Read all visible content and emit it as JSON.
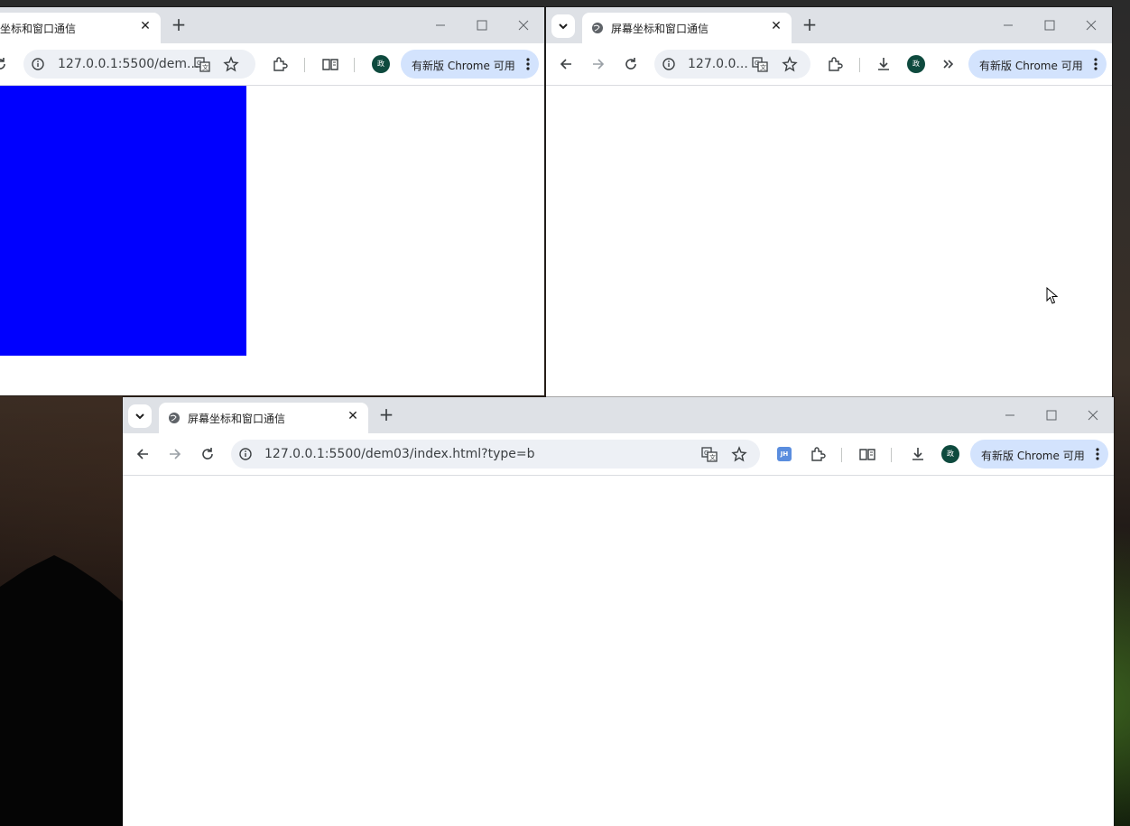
{
  "colors": {
    "blue_box": "#0000ff",
    "titlebar": "#dee1e6",
    "update_chip": "#d3e3fd",
    "avatar": "#0e4a3e"
  },
  "window_a": {
    "tab_title": "屏幕坐标和窗口通信",
    "tab_title_visible": "坐标和窗口通信",
    "url": "127.0.0.1:5500/dem...",
    "avatar_label": "政",
    "update_label": "有新版 Chrome 可用"
  },
  "window_c": {
    "tab_title": "屏幕坐标和窗口通信",
    "url": "127.0.0...",
    "avatar_label": "政",
    "update_label": "有新版 Chrome 可用"
  },
  "window_b": {
    "tab_title": "屏幕坐标和窗口通信",
    "url": "127.0.0.1:5500/dem03/index.html?type=b",
    "extension_badge": "JH",
    "avatar_label": "政",
    "update_label": "有新版 Chrome 可用"
  }
}
